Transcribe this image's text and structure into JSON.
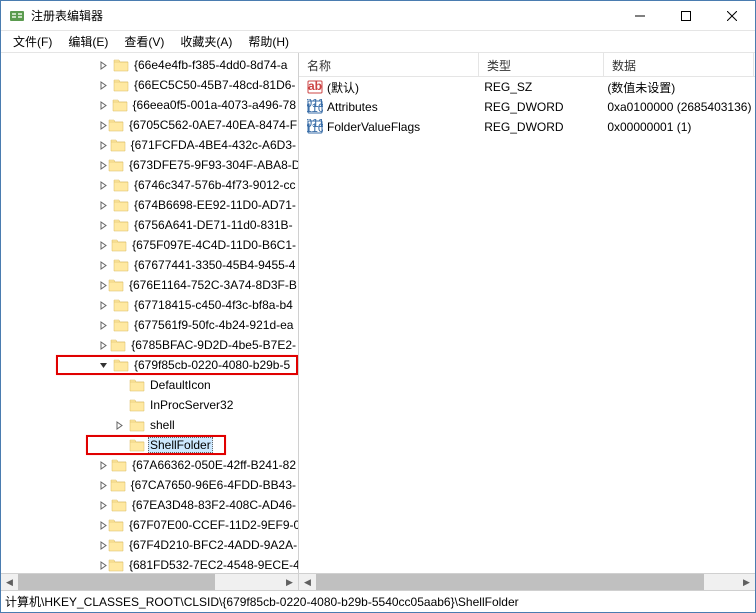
{
  "title": "注册表编辑器",
  "menu": {
    "file": "文件(F)",
    "edit": "编辑(E)",
    "view": "查看(V)",
    "favorites": "收藏夹(A)",
    "help": "帮助(H)"
  },
  "tree_nodes": [
    {
      "label": "{66e4e4fb-f385-4dd0-8d74-a",
      "depth": 3,
      "exp": ">"
    },
    {
      "label": "{66EC5C50-45B7-48cd-81D6-",
      "depth": 3,
      "exp": ">"
    },
    {
      "label": "{66eea0f5-001a-4073-a496-78",
      "depth": 3,
      "exp": ">"
    },
    {
      "label": "{6705C562-0AE7-40EA-8474-F",
      "depth": 3,
      "exp": ">"
    },
    {
      "label": "{671FCFDA-4BE4-432c-A6D3-",
      "depth": 3,
      "exp": ">"
    },
    {
      "label": "{673DFE75-9F93-304F-ABA8-D",
      "depth": 3,
      "exp": ">"
    },
    {
      "label": "{6746c347-576b-4f73-9012-cc",
      "depth": 3,
      "exp": ">"
    },
    {
      "label": "{674B6698-EE92-11D0-AD71-",
      "depth": 3,
      "exp": ">"
    },
    {
      "label": "{6756A641-DE71-11d0-831B-",
      "depth": 3,
      "exp": ">"
    },
    {
      "label": "{675F097E-4C4D-11D0-B6C1-",
      "depth": 3,
      "exp": ">"
    },
    {
      "label": "{67677441-3350-45B4-9455-4",
      "depth": 3,
      "exp": ">"
    },
    {
      "label": "{676E1164-752C-3A74-8D3F-B",
      "depth": 3,
      "exp": ">"
    },
    {
      "label": "{67718415-c450-4f3c-bf8a-b4",
      "depth": 3,
      "exp": ">"
    },
    {
      "label": "{677561f9-50fc-4b24-921d-ea",
      "depth": 3,
      "exp": ">"
    },
    {
      "label": "{6785BFAC-9D2D-4be5-B7E2-",
      "depth": 3,
      "exp": ">"
    },
    {
      "label": "{679f85cb-0220-4080-b29b-5",
      "depth": 3,
      "exp": "v",
      "redbox": true
    },
    {
      "label": "DefaultIcon",
      "depth": 4,
      "exp": ""
    },
    {
      "label": "InProcServer32",
      "depth": 4,
      "exp": ""
    },
    {
      "label": "shell",
      "depth": 4,
      "exp": ">"
    },
    {
      "label": "ShellFolder",
      "depth": 4,
      "exp": "",
      "selected": true,
      "redbox2": true
    },
    {
      "label": "{67A66362-050E-42ff-B241-82",
      "depth": 3,
      "exp": ">"
    },
    {
      "label": "{67CA7650-96E6-4FDD-BB43-",
      "depth": 3,
      "exp": ">"
    },
    {
      "label": "{67EA3D48-83F2-408C-AD46-",
      "depth": 3,
      "exp": ">"
    },
    {
      "label": "{67F07E00-CCEF-11D2-9EF9-0",
      "depth": 3,
      "exp": ">"
    },
    {
      "label": "{67F4D210-BFC2-4ADD-9A2A-",
      "depth": 3,
      "exp": ">"
    },
    {
      "label": "{681FD532-7EC2-4548-9ECE-4",
      "depth": 3,
      "exp": ">"
    }
  ],
  "columns": {
    "name": "名称",
    "type": "类型",
    "data": "数据"
  },
  "col_widths": {
    "name": 180,
    "type": 125,
    "data": 150
  },
  "values": [
    {
      "icon": "string",
      "name": "(默认)",
      "type": "REG_SZ",
      "data": "(数值未设置)"
    },
    {
      "icon": "binary",
      "name": "Attributes",
      "type": "REG_DWORD",
      "data": "0xa0100000 (2685403136)"
    },
    {
      "icon": "binary",
      "name": "FolderValueFlags",
      "type": "REG_DWORD",
      "data": "0x00000001 (1)"
    }
  ],
  "statusbar": "计算机\\HKEY_CLASSES_ROOT\\CLSID\\{679f85cb-0220-4080-b29b-5540cc05aab6}\\ShellFolder"
}
